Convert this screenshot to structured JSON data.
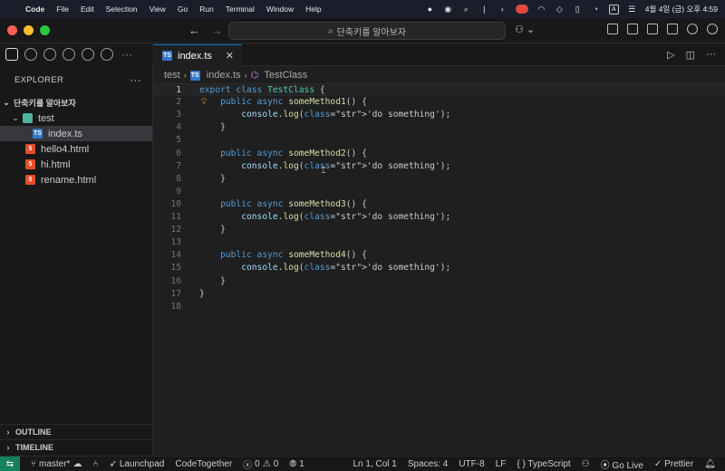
{
  "menubar": {
    "app": "Code",
    "items": [
      "File",
      "Edit",
      "Selection",
      "View",
      "Go",
      "Run",
      "Terminal",
      "Window",
      "Help"
    ],
    "input_indicator": "A",
    "clock": "4월 4일 (금) 오후 4:59"
  },
  "titlebar": {
    "search_text": "단축키를 알아보자"
  },
  "explorer": {
    "title": "EXPLORER",
    "workspace": "단축키를 알아보자",
    "folder": "test",
    "files": [
      {
        "name": "index.ts",
        "type": "ts",
        "indent": 2,
        "selected": true
      },
      {
        "name": "hello4.html",
        "type": "html",
        "indent": 1,
        "selected": false
      },
      {
        "name": "hi.html",
        "type": "html",
        "indent": 1,
        "selected": false
      },
      {
        "name": "rename.html",
        "type": "html",
        "indent": 1,
        "selected": false
      }
    ],
    "outline": "OUTLINE",
    "timeline": "TIMELINE"
  },
  "editor": {
    "tab": "index.ts",
    "breadcrumb": [
      "test",
      "index.ts",
      "TestClass"
    ],
    "lines": [
      "export class TestClass {",
      "    public async someMethod1() {",
      "        console.log('do something');",
      "    }",
      "",
      "    public async someMethod2() {",
      "        console.log('do something');",
      "    }",
      "",
      "    public async someMethod3() {",
      "        console.log('do something');",
      "    }",
      "",
      "    public async someMethod4() {",
      "        console.log('do something');",
      "    }",
      "}",
      ""
    ],
    "current_line": 1
  },
  "statusbar": {
    "branch": "master*",
    "launchpad": "Launchpad",
    "codetogether": "CodeTogether",
    "errors": "0",
    "warnings": "0",
    "ports": "1",
    "position": "Ln 1, Col 1",
    "spaces": "Spaces: 4",
    "encoding": "UTF-8",
    "eol": "LF",
    "language": "TypeScript",
    "golive": "Go Live",
    "prettier": "Prettier"
  },
  "colors": {
    "accent": "#0078d4",
    "remote": "#16825d",
    "keyword": "#569cd6",
    "class": "#4ec9b0",
    "function": "#dcdcaa",
    "string": "#ce9178"
  }
}
